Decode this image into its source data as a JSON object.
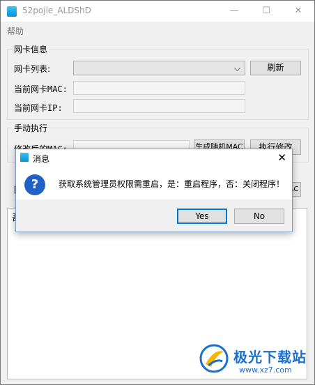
{
  "window": {
    "title": "52pojie_ALDShD",
    "minimize_glyph": "—",
    "maximize_glyph": "☐",
    "close_glyph": "✕"
  },
  "menu": {
    "help": "帮助"
  },
  "nic_group": {
    "title": "网卡信息",
    "nic_list_label": "网卡列表:",
    "nic_list_value": "",
    "refresh_button": "刷新",
    "current_mac_label": "当前网卡MAC:",
    "current_mac_value": "",
    "current_ip_label": "当前网卡IP:",
    "current_ip_value": ""
  },
  "manual_group": {
    "title": "手动执行",
    "modified_mac_label": "修改后的MAC:",
    "modified_mac_value": "",
    "generate_random_button": "生成随机MAC",
    "execute_button": "执行修改"
  },
  "partial": {
    "row_left": "[",
    "row_right_button": "AC",
    "textarea_text": "吾"
  },
  "dialog": {
    "title": "消息",
    "close_glyph": "✕",
    "icon_glyph": "?",
    "message": "获取系统管理员权限需重启，是：重启程序，否：关闭程序！",
    "yes_button": "Yes",
    "no_button": "No"
  },
  "watermark": {
    "text": "极光下载站",
    "url": "www.xz7.com"
  },
  "colors": {
    "accent": "#0078d7",
    "question_icon": "#1f61c6",
    "watermark": "#1a6fd0"
  }
}
